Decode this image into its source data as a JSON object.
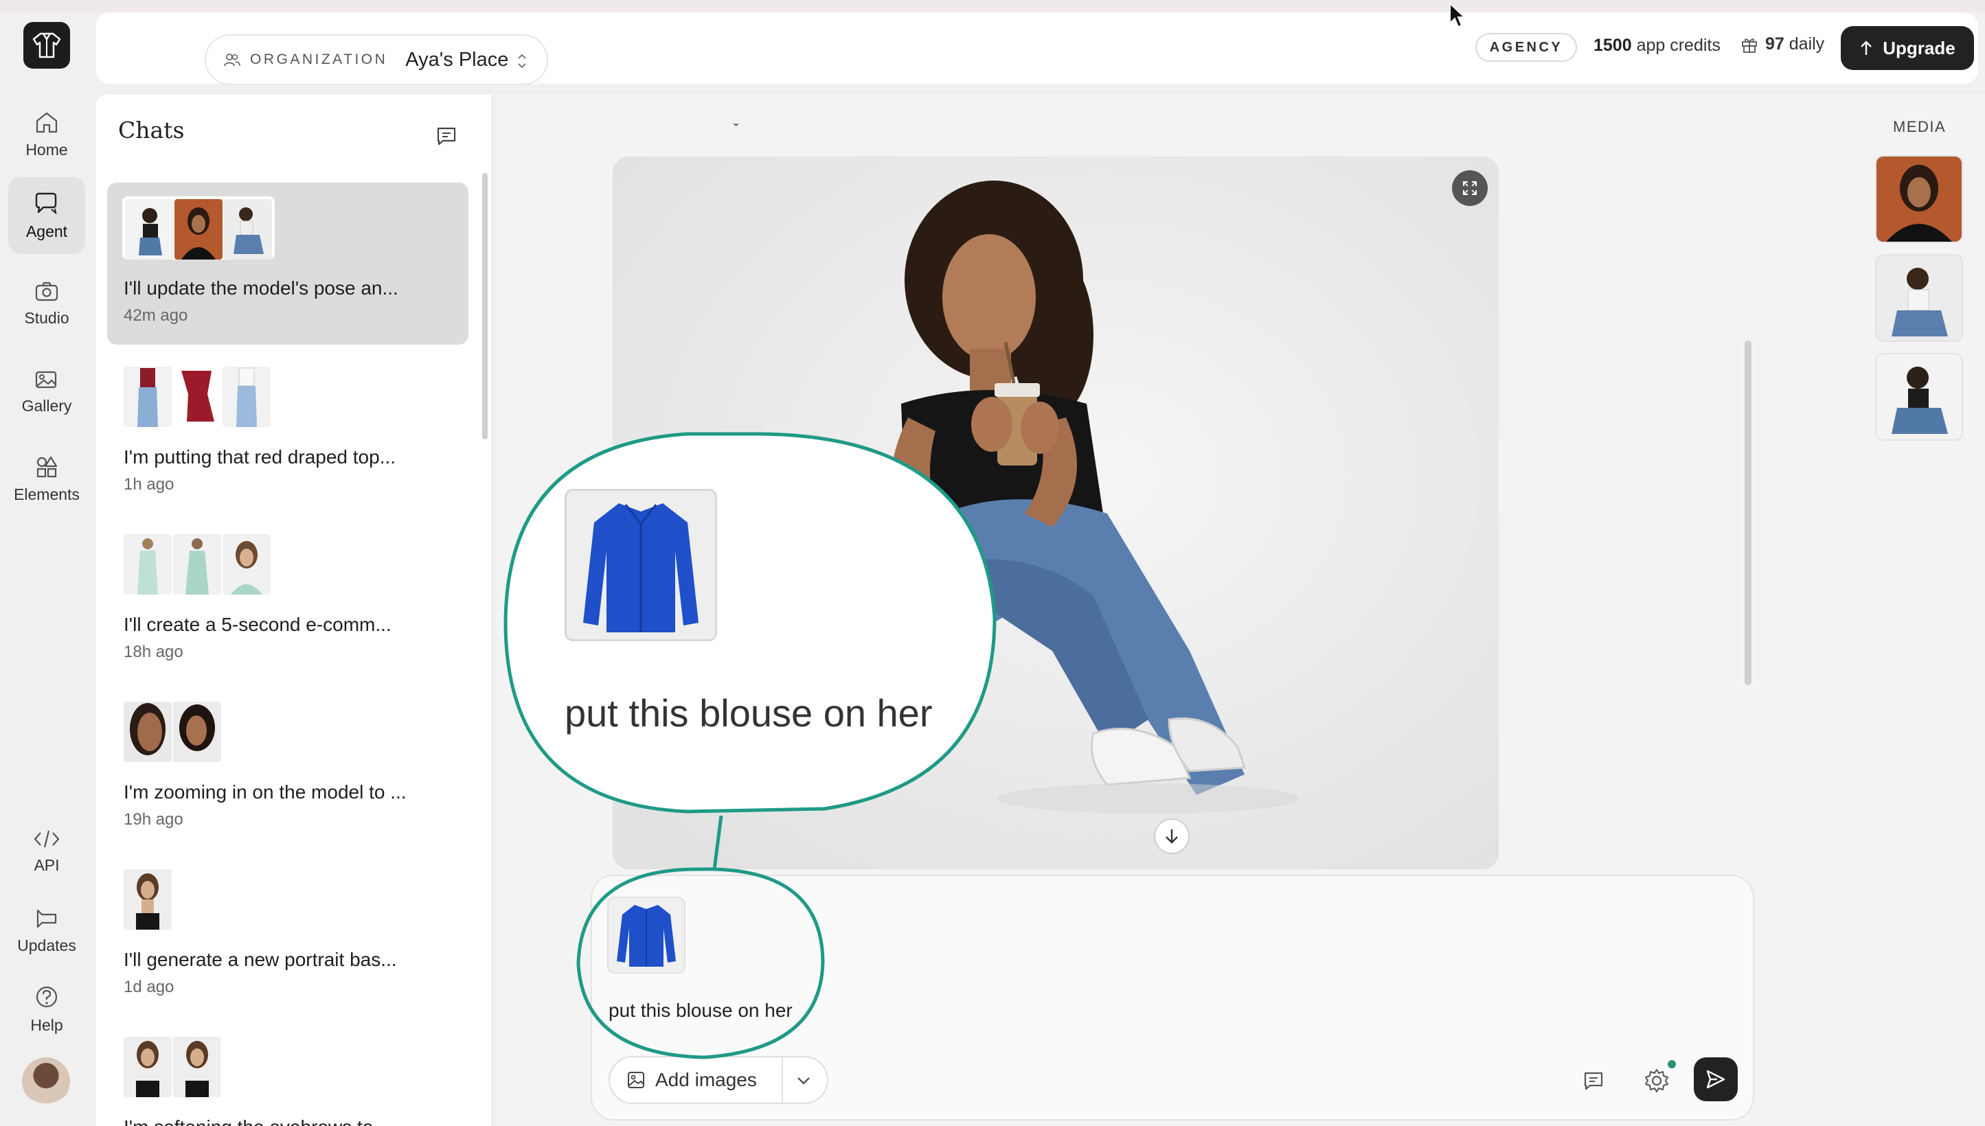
{
  "topbar": {
    "org_label": "ORGANIZATION",
    "org_name": "Aya's Place",
    "plan_badge": "AGENCY",
    "credits_value": "1500",
    "credits_suffix": "app credits",
    "daily_value": "97",
    "daily_suffix": "daily",
    "upgrade_label": "Upgrade"
  },
  "nav": {
    "items": [
      {
        "label": "Home",
        "icon": "home-icon"
      },
      {
        "label": "Agent",
        "icon": "chat-icon"
      },
      {
        "label": "Studio",
        "icon": "camera-icon"
      },
      {
        "label": "Gallery",
        "icon": "images-icon"
      },
      {
        "label": "Elements",
        "icon": "shapes-icon"
      }
    ],
    "bottom_items": [
      {
        "label": "API",
        "icon": "code-icon"
      },
      {
        "label": "Updates",
        "icon": "megaphone-icon"
      },
      {
        "label": "Help",
        "icon": "help-icon"
      }
    ],
    "active": "Agent"
  },
  "chats": {
    "title": "Chats",
    "items": [
      {
        "title": "I'll update the model's pose an...",
        "time": "42m ago"
      },
      {
        "title": "I'm putting that red draped top...",
        "time": "1h ago"
      },
      {
        "title": "I'll create a 5-second e-comm...",
        "time": "18h ago"
      },
      {
        "title": "I'm zooming in on the model to ...",
        "time": "19h ago"
      },
      {
        "title": "I'll generate a new portrait bas...",
        "time": "1d ago"
      },
      {
        "title": "I'm softening the eyebrows to...",
        "time": ""
      }
    ]
  },
  "main": {
    "collapse_glyph": "ˇ"
  },
  "composer": {
    "message": "put this blouse on her",
    "add_images_label": "Add images"
  },
  "callout": {
    "text": "put this blouse on her"
  },
  "media": {
    "label": "MEDIA"
  },
  "colors": {
    "accent_teal": "#1f9a86",
    "dark_button": "#222222",
    "blouse_blue": "#1f4fc9"
  }
}
